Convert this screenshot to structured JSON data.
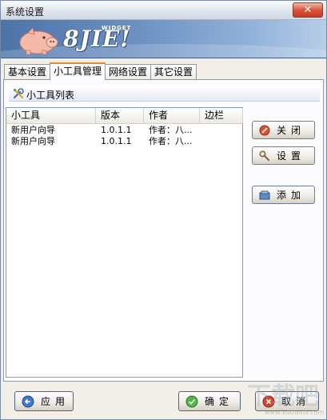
{
  "window": {
    "title": "系统设置",
    "close_label": "✕"
  },
  "banner": {
    "logo_text": "8JIE!",
    "logo_subtext": "WIDGET"
  },
  "tabs": [
    {
      "label": "基本设置",
      "active": false
    },
    {
      "label": "小工具管理",
      "active": true
    },
    {
      "label": "网络设置",
      "active": false
    },
    {
      "label": "其它设置",
      "active": false
    }
  ],
  "section": {
    "title": "小工具列表"
  },
  "list": {
    "columns": [
      "小工具",
      "版本",
      "作者",
      "边栏"
    ],
    "rows": [
      {
        "name": "新用户向导",
        "version": "1.0.1.1",
        "author": "作者：八...",
        "sidebar": ""
      },
      {
        "name": "新用户向导",
        "version": "1.0.1.1",
        "author": "作者：八...",
        "sidebar": ""
      }
    ]
  },
  "side_buttons": {
    "close": "关闭",
    "settings": "设置",
    "add": "添加"
  },
  "bottom_buttons": {
    "apply": "应用",
    "ok": "确定",
    "cancel": "取消"
  },
  "watermark": {
    "text": "www.xiazaiba.com"
  },
  "colors": {
    "tab_accent": "#e68b2c",
    "banner": "#5f86ba",
    "close_button": "#d9553a"
  }
}
